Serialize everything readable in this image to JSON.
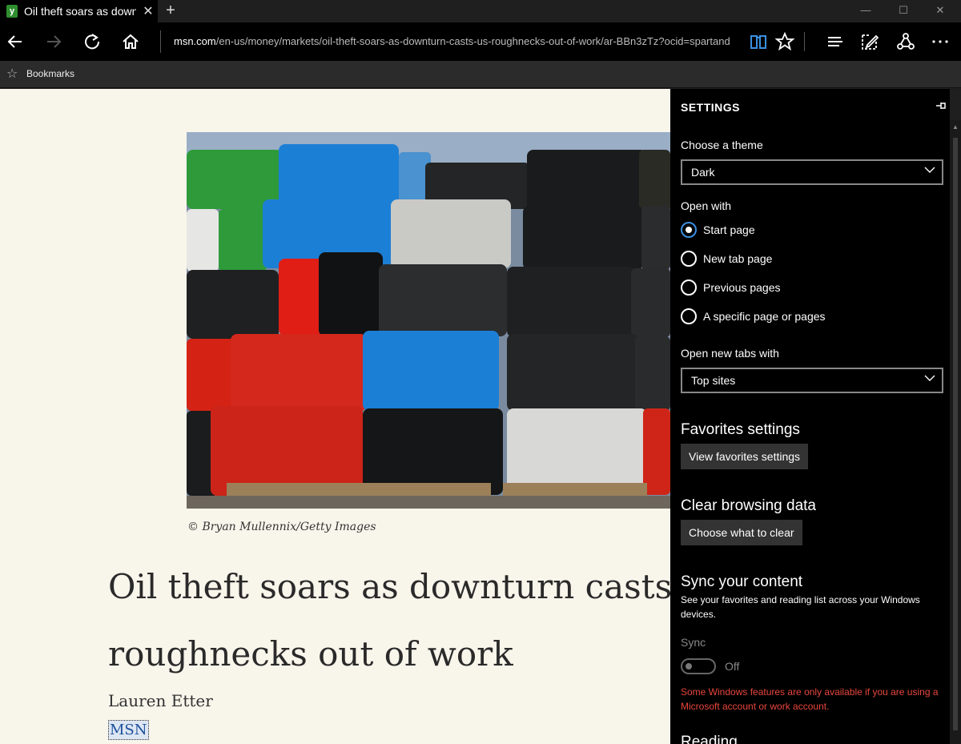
{
  "titlebar": {
    "tab_title": "Oil theft soars as downt",
    "close_tab": "✕",
    "new_tab": "+",
    "minimize": "—",
    "maximize": "☐",
    "close_window": "✕"
  },
  "navbar": {
    "url_domain": "msn.com",
    "url_path": "/en-us/money/markets/oil-theft-soars-as-downturn-casts-us-roughnecks-out-of-work/ar-BBn3zTz?ocid=spartand"
  },
  "favorites_bar": {
    "label": "Bookmarks"
  },
  "article": {
    "caption": "© Bryan Mullennix/Getty Images",
    "headline": "Oil theft soars as downturn casts U.S. roughnecks out of work",
    "author": "Lauren Etter",
    "source": "MSN"
  },
  "settings": {
    "title": "SETTINGS",
    "theme_label": "Choose a theme",
    "theme_value": "Dark",
    "open_with_label": "Open with",
    "open_with_options": [
      "Start page",
      "New tab page",
      "Previous pages",
      "A specific page or pages"
    ],
    "open_with_selected": "Start page",
    "new_tabs_label": "Open new tabs with",
    "new_tabs_value": "Top sites",
    "favorites_heading": "Favorites settings",
    "favorites_button": "View favorites settings",
    "clear_heading": "Clear browsing data",
    "clear_button": "Choose what to clear",
    "sync_heading": "Sync your content",
    "sync_desc": "See your favorites and reading list across your Windows devices.",
    "sync_label": "Sync",
    "sync_state": "Off",
    "sync_warning": "Some Windows features are only available if you are using a Microsoft account or work account.",
    "reading_heading": "Reading"
  },
  "colors": {
    "accent": "#3a8fe0",
    "warning": "#e8463c",
    "page_bg": "#f8f5eb",
    "panel_bg": "#000000"
  }
}
